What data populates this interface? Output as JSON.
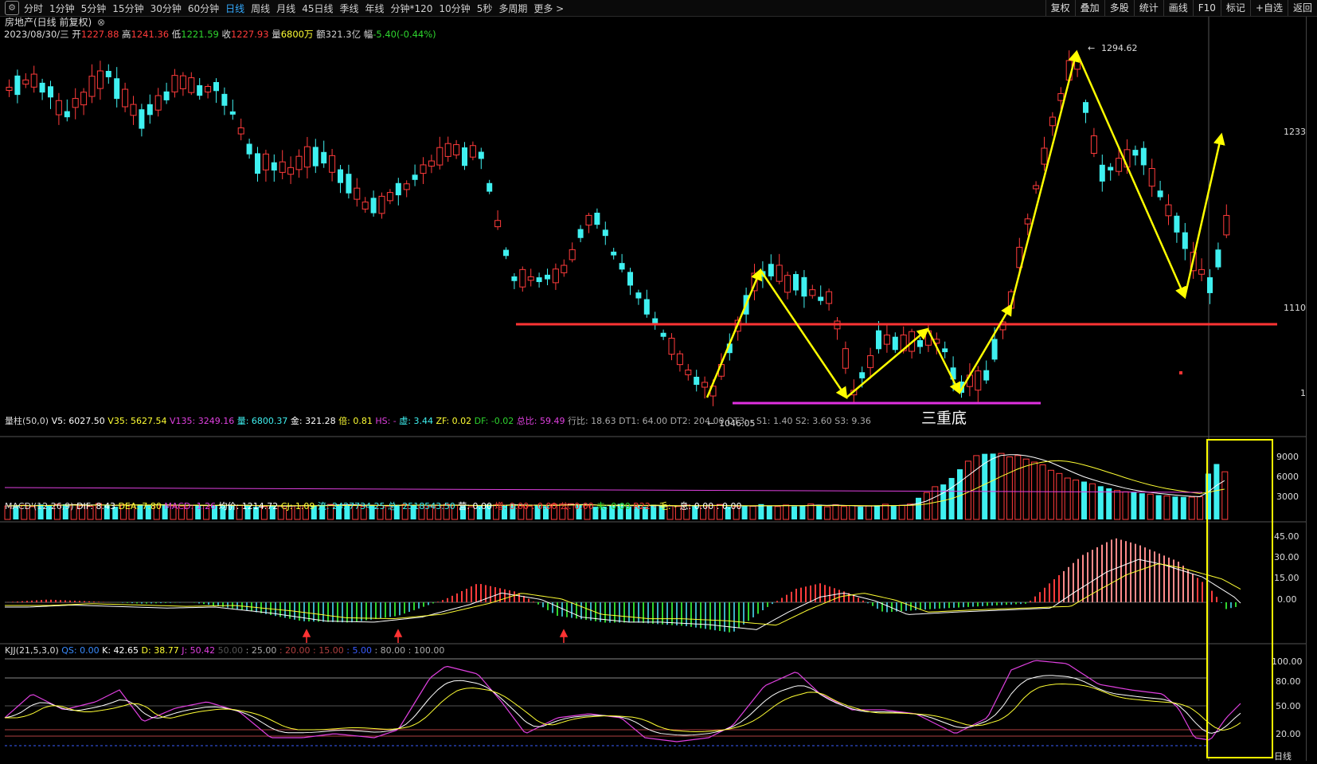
{
  "toolbar": {
    "icon": "settings-icon",
    "periods": [
      "分时",
      "1分钟",
      "5分钟",
      "15分钟",
      "30分钟",
      "60分钟",
      "日线",
      "周线",
      "月线",
      "45日线",
      "季线",
      "年线",
      "分钟*120",
      "10分钟",
      "5秒",
      "多周期",
      "更多 >"
    ],
    "active_period": "日线",
    "actions": [
      "复权",
      "叠加",
      "多股",
      "统计",
      "画线",
      "F10",
      "标记",
      "+自选",
      "返回"
    ]
  },
  "header": {
    "stock_name": "房地产(日线 前复权)",
    "date": "2023/08/30/三",
    "ohlc": [
      {
        "label": "开",
        "value": "1227.88",
        "color": "#ff3b3b"
      },
      {
        "label": "高",
        "value": "1241.36",
        "color": "#ff3b3b"
      },
      {
        "label": "低",
        "value": "1221.59",
        "color": "#2ed52e"
      },
      {
        "label": "收",
        "value": "1227.93",
        "color": "#ff3b3b"
      },
      {
        "label": "量",
        "value": "6800万",
        "color": "#ffff33"
      },
      {
        "label": "额",
        "value": "321.3亿",
        "color": "#cccccc"
      },
      {
        "label": "幅",
        "value": "-5.40(-0.44%)",
        "color": "#2ed52e"
      }
    ]
  },
  "main_chart": {
    "price_labels": [
      "1233",
      "1110",
      "1"
    ],
    "annotations": {
      "high": "1294.62",
      "low": "1046.05",
      "pattern": "三重底"
    },
    "colors": {
      "up": "#ff3b3b",
      "down": "#3ff0f0",
      "resistance": "#ff3333",
      "support": "#e030e0",
      "arrow": "#ffff00"
    },
    "candles_up": [
      1,
      0,
      1,
      1,
      0,
      0,
      1,
      0,
      1,
      1,
      1,
      1,
      0,
      0,
      1,
      1,
      0,
      0,
      1,
      0,
      1,
      1,
      1,
      0,
      1,
      0,
      0,
      0,
      1,
      0,
      0,
      1,
      0,
      1,
      1,
      1,
      1,
      0,
      0,
      1,
      0,
      0,
      1,
      1,
      0,
      1,
      1,
      0,
      1,
      0,
      1,
      1,
      1,
      1,
      1,
      0,
      1,
      0,
      0,
      1,
      0,
      0,
      1,
      1,
      0,
      0,
      1,
      1,
      1,
      0,
      1,
      0,
      0,
      0,
      0,
      0,
      0,
      0,
      0,
      0,
      1,
      1,
      1,
      0,
      1,
      1,
      1,
      0,
      1,
      0,
      1,
      0,
      0,
      1,
      1,
      0,
      0,
      1,
      0,
      1,
      1,
      1,
      1,
      0,
      1,
      0,
      1,
      0,
      1,
      1,
      0,
      1,
      1,
      0,
      0,
      0,
      1,
      1,
      0,
      0,
      1,
      1,
      1,
      1,
      1,
      1,
      1,
      1,
      1,
      1,
      0,
      1,
      0,
      0,
      1,
      1,
      0,
      0,
      1,
      0,
      1,
      0,
      0,
      1,
      1,
      0,
      0,
      1
    ]
  },
  "volume_panel": {
    "indicator_line": [
      {
        "t": "量柱(50,0)",
        "c": "#dddddd"
      },
      {
        "t": "V5: 6027.50",
        "c": "#ffffff"
      },
      {
        "t": "V35: 5627.54",
        "c": "#ffff33"
      },
      {
        "t": "V135: 3249.16",
        "c": "#e040e0"
      },
      {
        "t": "量: 6800.37",
        "c": "#3ff0f0"
      },
      {
        "t": "金: 321.28",
        "c": "#ffffff"
      },
      {
        "t": "倍: 0.81",
        "c": "#ffff33"
      },
      {
        "t": "HS: -",
        "c": "#e040e0"
      },
      {
        "t": "虚: 3.44",
        "c": "#3ff0f0"
      },
      {
        "t": "ZF: 0.02",
        "c": "#ffff33"
      },
      {
        "t": "DF: -0.02",
        "c": "#2ed52e"
      },
      {
        "t": "总比: 59.49",
        "c": "#e040e0"
      },
      {
        "t": "行比: 18.63",
        "c": "#aaaaaa"
      },
      {
        "t": "DT1: 64.00",
        "c": "#aaaaaa"
      },
      {
        "t": "DT2: 204.00",
        "c": "#aaaaaa"
      },
      {
        "t": "DT3: -",
        "c": "#aaaaaa"
      },
      {
        "t": "S1: 1.40",
        "c": "#aaaaaa"
      },
      {
        "t": "S2: 3.60",
        "c": "#aaaaaa"
      },
      {
        "t": "S3: 9.36",
        "c": "#aaaaaa"
      }
    ],
    "axis_labels": [
      "9000",
      "6000",
      "3000"
    ],
    "volumes": [
      1925,
      2003,
      2032,
      1824,
      2126,
      2045,
      2164,
      2155,
      2124,
      1955,
      1877,
      2262,
      2098,
      1809,
      2102,
      2089,
      2136,
      2051,
      2050,
      2130,
      1942,
      1909,
      1980,
      2045,
      1975,
      2002,
      2002,
      1971,
      2015,
      2069,
      1797,
      1831,
      2025,
      1891,
      1918,
      1964,
      2001,
      1954,
      2064,
      2139,
      2138,
      2130,
      1976,
      1871,
      2039,
      2016,
      1909,
      2071,
      2134,
      1987,
      2037,
      1910,
      2052,
      2147,
      2051,
      1922,
      1811,
      1925,
      2132,
      2070,
      2075,
      2209,
      1935,
      1911,
      2070,
      1902,
      2169,
      2193,
      2243,
      2106,
      2014,
      1800,
      1816,
      2043,
      2215,
      1812,
      2023,
      1791,
      2089,
      2007,
      1922,
      1848,
      2050,
      2015,
      1955,
      2025,
      2139,
      1820,
      1871,
      1897,
      1879,
      2181,
      1915,
      1840,
      2051,
      1872,
      2018,
      2200,
      2104,
      1801,
      2087,
      1846,
      1989,
      1811,
      1914,
      2010,
      2164,
      1916,
      2023,
      2192,
      3087,
      3842,
      4670,
      4990,
      5913,
      7155,
      8311,
      9105,
      9357,
      9387,
      9418,
      8923,
      9110,
      8612,
      8178,
      7787,
      7011,
      6554,
      5906,
      5614,
      5398,
      5086,
      4736,
      4433,
      4133,
      3944,
      3875,
      3729,
      3606,
      3464,
      3353,
      3260,
      3203,
      3186,
      3229,
      6538,
      7904,
      6800
    ]
  },
  "macd_panel": {
    "indicator_line": [
      {
        "t": "MACD'(12,26,9)",
        "c": "#dddddd"
      },
      {
        "t": "DIF: 8.43",
        "c": "#ffffff"
      },
      {
        "t": "DEA: 7.80",
        "c": "#ffff33"
      },
      {
        "t": "MACD: 1.26",
        "c": "#e040e0"
      },
      {
        "t": "均价: 1214.72",
        "c": "#ffffff"
      },
      {
        "t": "CJ: 1.09",
        "c": "#ffff33"
      },
      {
        "t": "流: 2427734.25",
        "c": "#3ff0f0"
      },
      {
        "t": "总: 2518543.50",
        "c": "#3ff0f0"
      },
      {
        "t": "营: 0.00",
        "c": "#ffffff"
      },
      {
        "t": "增: 0.00 : 0.00",
        "c": "#ff3b3b"
      },
      {
        "t": "公: 0.00",
        "c": "#ff3b3b"
      },
      {
        "t": "未: 0.00",
        "c": "#2ed52e"
      },
      {
        "t": "R22 -",
        "c": "#ff3b3b"
      },
      {
        "t": "毛: -",
        "c": "#ffff33"
      },
      {
        "t": "息: 0.00 : 0.00",
        "c": "#ffffff"
      }
    ],
    "axis_labels": [
      "45.00",
      "30.00",
      "15.00",
      "0.00"
    ]
  },
  "kjj_panel": {
    "indicator_line": [
      {
        "t": "KJJ(21,5,3,0)",
        "c": "#dddddd"
      },
      {
        "t": "QS: 0.00",
        "c": "#3a8cff"
      },
      {
        "t": "K: 42.65",
        "c": "#ffffff"
      },
      {
        "t": "D: 38.77",
        "c": "#ffff33"
      },
      {
        "t": "J: 50.42",
        "c": "#e040e0"
      },
      {
        "t": "50.00",
        "c": "#555555"
      },
      {
        "t": ": 25.00",
        "c": "#aaaaaa"
      },
      {
        "t": ": 20.00",
        "c": "#b04040"
      },
      {
        "t": ": 15.00",
        "c": "#b04040"
      },
      {
        "t": ": 5.00",
        "c": "#3a5cff"
      },
      {
        "t": ": 80.00",
        "c": "#aaaaaa"
      },
      {
        "t": ": 100.00",
        "c": "#aaaaaa"
      }
    ],
    "axis_labels": [
      "100.00",
      "80.00",
      "50.00",
      "20.00"
    ],
    "bottom_label": "日线"
  }
}
